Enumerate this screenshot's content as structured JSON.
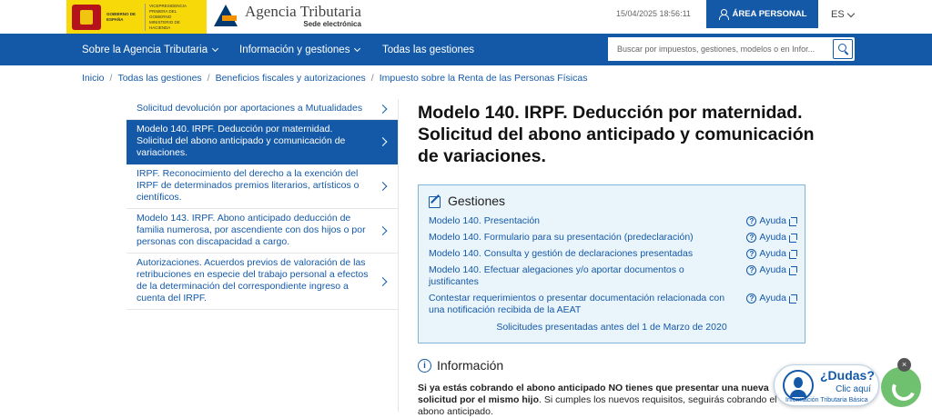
{
  "header": {
    "gov_text": "GOBIERNO DE ESPAÑA",
    "vice_text": "VICEPRESIDENCIA PRIMERA DEL GOBIERNO",
    "ministry_text": "MINISTERIO DE HACIENDA",
    "agency_name": "Agencia Tributaria",
    "agency_sub": "Sede electrónica",
    "datetime": "15/04/2025 18:56:11",
    "area_personal": "ÁREA PERSONAL",
    "lang": "ES"
  },
  "nav": {
    "items": [
      "Sobre la Agencia Tributaria",
      "Información y gestiones",
      "Todas las gestiones"
    ],
    "search_placeholder": "Buscar por impuestos, gestiones, modelos o en Infor..."
  },
  "breadcrumb": [
    "Inicio",
    "Todas las gestiones",
    "Beneficios fiscales y autorizaciones",
    "Impuesto sobre la Renta de las Personas Físicas"
  ],
  "sidebar": {
    "items": [
      "Solicitud devolución por aportaciones a Mutualidades",
      "Modelo 140. IRPF. Deducción por maternidad. Solicitud del abono anticipado y comunicación de variaciones.",
      "IRPF. Reconocimiento del derecho a la exención del IRPF de determinados premios literarios, artísticos o científicos.",
      "Modelo 143. IRPF. Abono anticipado deducción de familia numerosa, por ascendiente con dos hijos o por personas con discapacidad a cargo.",
      "Autorizaciones. Acuerdos previos de valoración de las retribuciones en especie del trabajo personal a efectos de la determinación del correspondiente ingreso a cuenta del IRPF."
    ]
  },
  "main": {
    "title": "Modelo 140. IRPF. Deducción por maternidad. Solicitud del abono anticipado y comunicación de variaciones.",
    "gestiones": {
      "heading": "Gestiones",
      "ayuda_label": "Ayuda",
      "rows": [
        "Modelo 140. Presentación",
        "Modelo 140. Formulario para su presentación (predeclaración)",
        "Modelo 140. Consulta y gestión de declaraciones presentadas",
        "Modelo 140. Efectuar alegaciones y/o aportar documentos o justificantes",
        "Contestar requerimientos o presentar documentación relacionada con una notificación recibida de la AEAT"
      ],
      "previous": "Solicitudes presentadas antes del 1 de Marzo de 2020"
    },
    "info": {
      "heading": "Información",
      "bold": "Si ya estás cobrando el abono anticipado NO tienes que presentar una nueva solicitud por el mismo hijo",
      "rest": ". Si cumples los nuevos requisitos, seguirás cobrando el abono anticipado."
    }
  },
  "help_widget": {
    "question": "¿Dudas?",
    "click": "Clic aquí",
    "info": "Información Tributaria Básica",
    "close": "×"
  }
}
